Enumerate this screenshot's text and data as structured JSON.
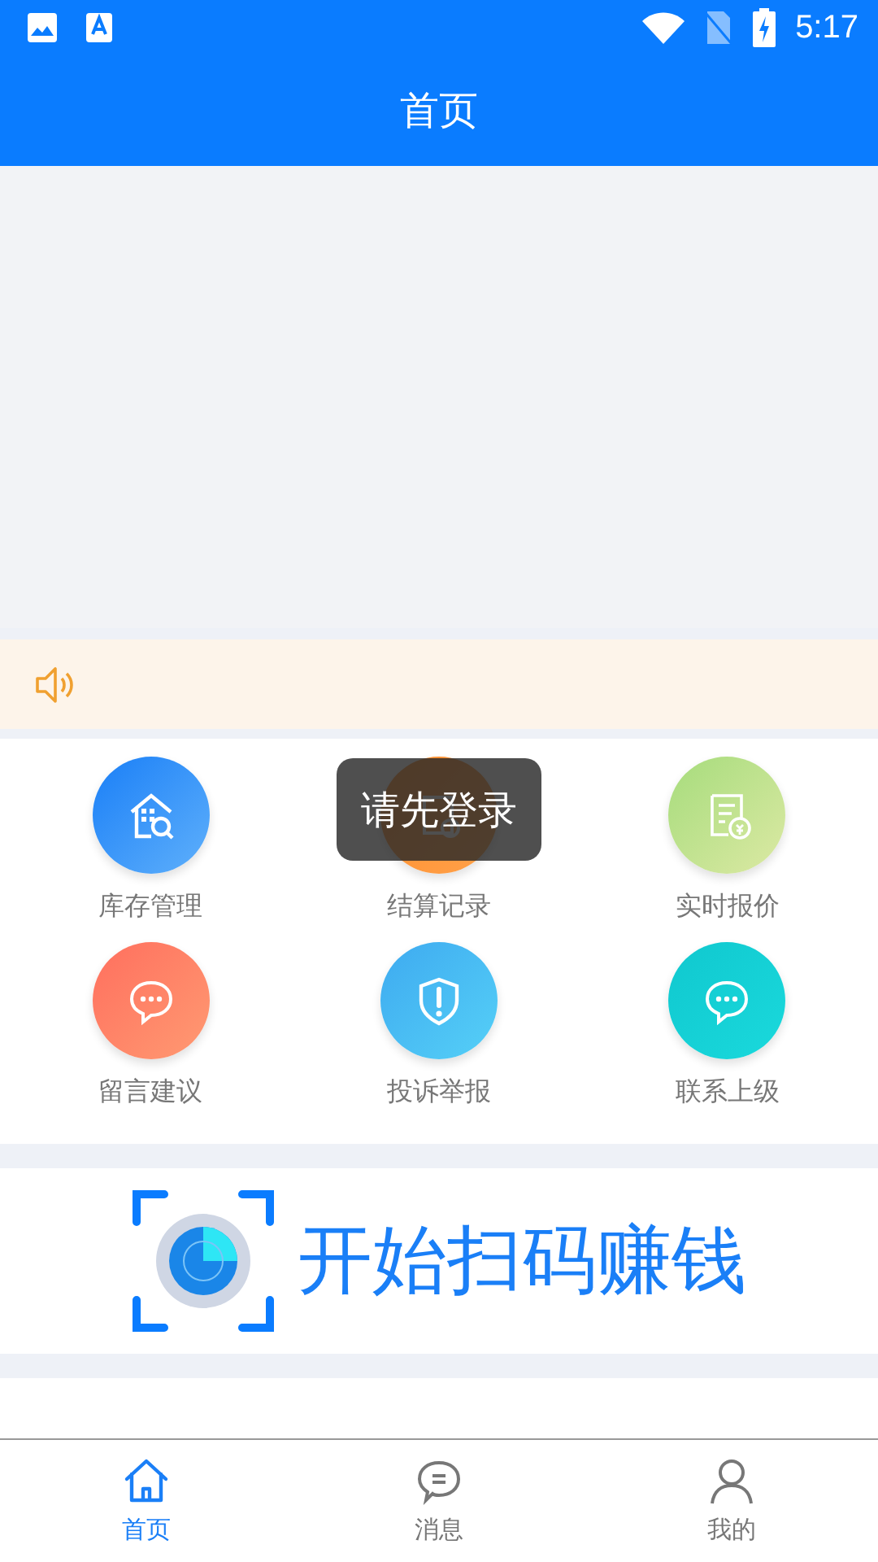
{
  "status_bar": {
    "time": "5:17"
  },
  "header": {
    "title": "首页"
  },
  "menu": [
    {
      "label": "库存管理",
      "kind": "inventory"
    },
    {
      "label": "结算记录",
      "kind": "settlement"
    },
    {
      "label": "实时报价",
      "kind": "quote"
    },
    {
      "label": "留言建议",
      "kind": "message"
    },
    {
      "label": "投诉举报",
      "kind": "complaint"
    },
    {
      "label": "联系上级",
      "kind": "contact"
    }
  ],
  "toast": {
    "text": "请先登录"
  },
  "scan_banner": {
    "text": "开始扫码赚钱"
  },
  "tabs": [
    {
      "label": "首页",
      "kind": "home",
      "selected": true
    },
    {
      "label": "消息",
      "kind": "messages",
      "selected": false
    },
    {
      "label": "我的",
      "kind": "profile",
      "selected": false
    }
  ]
}
